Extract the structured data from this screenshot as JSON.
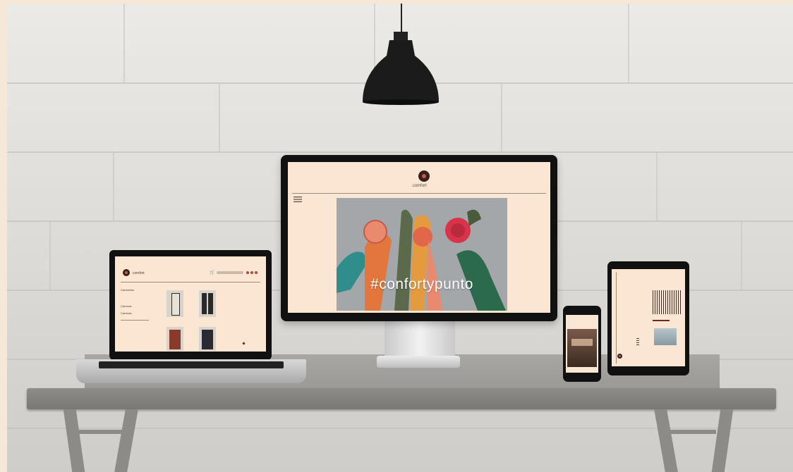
{
  "brand": {
    "name": ".comfort",
    "laptop_name": "comfort"
  },
  "hero": {
    "hashtag": "#confortypunto"
  },
  "laptop": {
    "sidebar": [
      "Camisetas",
      "Camisas",
      "Camisas"
    ],
    "products": [
      "",
      "",
      "",
      ""
    ]
  },
  "colors": {
    "screen_bg": "#fbe6d3",
    "logo_dark": "#3a1f1a",
    "logo_accent": "#c65a4a"
  },
  "icons": {
    "menu": "hamburger-menu-icon",
    "cart": "cart-icon",
    "lamp": "pendant-lamp"
  }
}
